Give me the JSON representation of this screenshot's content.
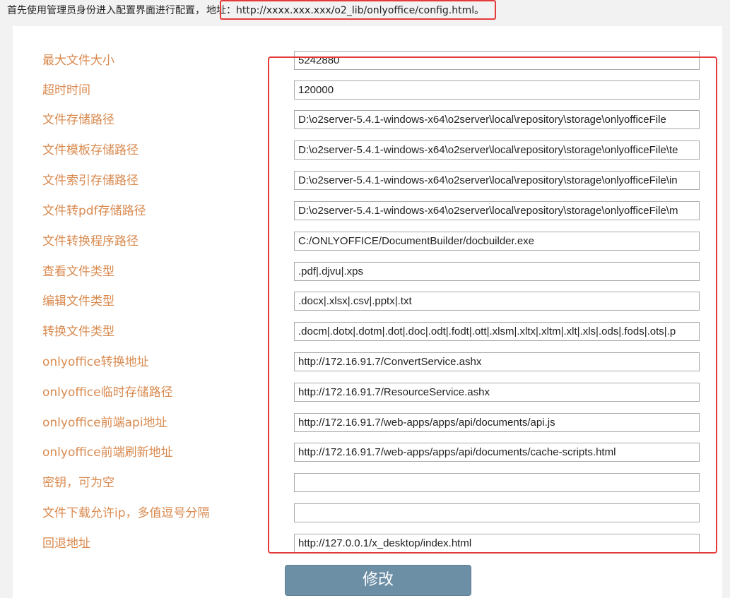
{
  "instruction": {
    "text": "首先使用管理员身份进入配置界面进行配置，",
    "address": "地址：http://xxxx.xxx.xxx/o2_lib/onlyoffice/config.html。"
  },
  "config_form": {
    "fields": [
      {
        "label": "最大文件大小",
        "value": "5242880"
      },
      {
        "label": "超时时间",
        "value": "120000"
      },
      {
        "label": "文件存储路径",
        "value": "D:\\o2server-5.4.1-windows-x64\\o2server\\local\\repository\\storage\\onlyofficeFile"
      },
      {
        "label": "文件模板存储路径",
        "value": "D:\\o2server-5.4.1-windows-x64\\o2server\\local\\repository\\storage\\onlyofficeFile\\te"
      },
      {
        "label": "文件索引存储路径",
        "value": "D:\\o2server-5.4.1-windows-x64\\o2server\\local\\repository\\storage\\onlyofficeFile\\in"
      },
      {
        "label": "文件转pdf存储路径",
        "value": "D:\\o2server-5.4.1-windows-x64\\o2server\\local\\repository\\storage\\onlyofficeFile\\m"
      },
      {
        "label": "文件转换程序路径",
        "value": "C:/ONLYOFFICE/DocumentBuilder/docbuilder.exe"
      },
      {
        "label": "查看文件类型",
        "value": ".pdf|.djvu|.xps"
      },
      {
        "label": "编辑文件类型",
        "value": ".docx|.xlsx|.csv|.pptx|.txt"
      },
      {
        "label": "转换文件类型",
        "value": ".docm|.dotx|.dotm|.dot|.doc|.odt|.fodt|.ott|.xlsm|.xltx|.xltm|.xlt|.xls|.ods|.fods|.ots|.p"
      },
      {
        "label": "onlyoffice转换地址",
        "value": "http://172.16.91.7/ConvertService.ashx"
      },
      {
        "label": "onlyoffice临时存储路径",
        "value": "http://172.16.91.7/ResourceService.ashx"
      },
      {
        "label": "onlyoffice前端api地址",
        "value": "http://172.16.91.7/web-apps/apps/api/documents/api.js"
      },
      {
        "label": "onlyoffice前端刷新地址",
        "value": "http://172.16.91.7/web-apps/apps/api/documents/cache-scripts.html"
      },
      {
        "label": "密钥，可为空",
        "value": ""
      },
      {
        "label": "文件下载允许ip，多值逗号分隔",
        "value": ""
      },
      {
        "label": "回退地址",
        "value": "http://127.0.0.1/x_desktop/index.html"
      }
    ],
    "submit_label": "修改"
  },
  "colors": {
    "label": "#d98a4f",
    "highlight": "#e53a3a",
    "button": "#6d8fa6"
  }
}
